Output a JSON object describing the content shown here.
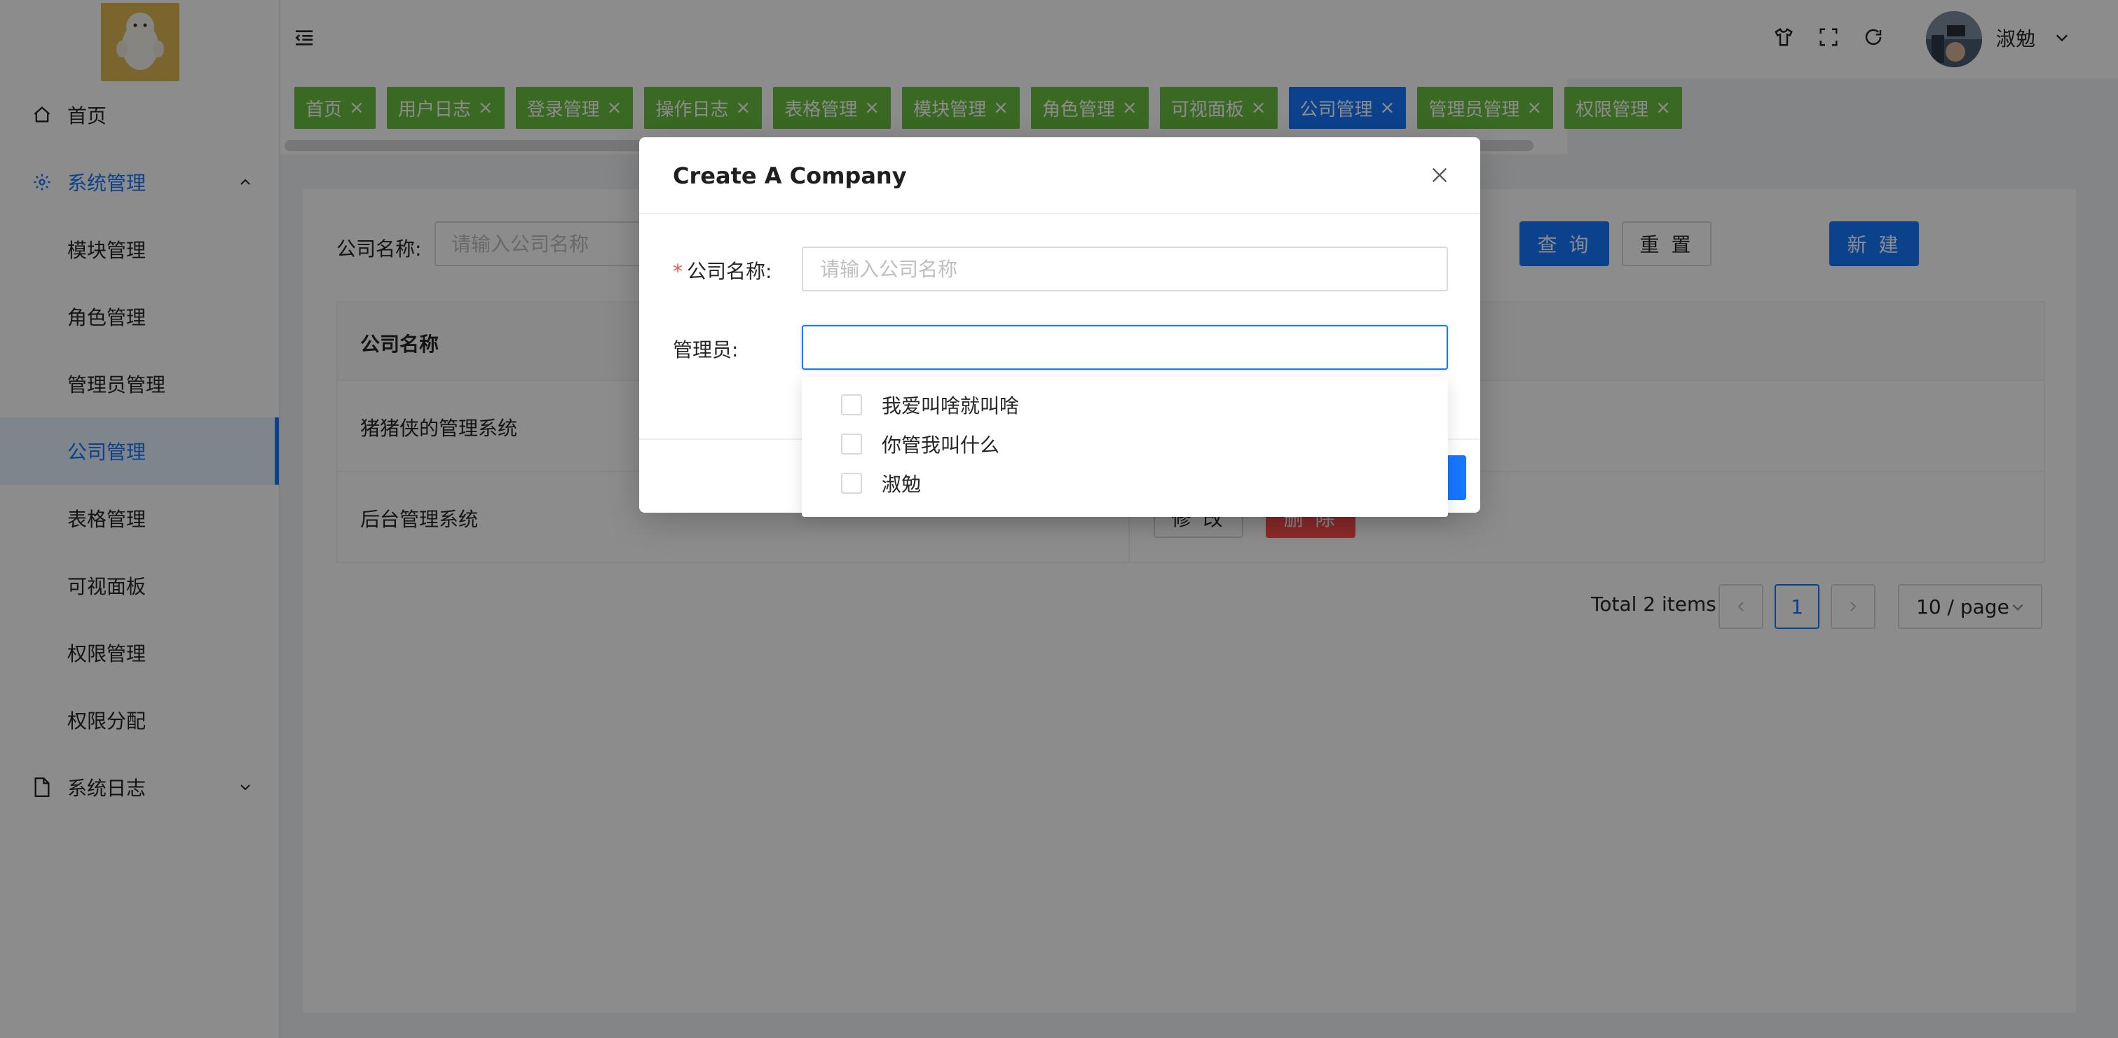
{
  "sidebar": {
    "items": [
      {
        "label": "首页",
        "icon": "home-icon"
      },
      {
        "label": "系统管理",
        "icon": "gear-icon",
        "expanded": true
      },
      {
        "label": "模块管理"
      },
      {
        "label": "角色管理"
      },
      {
        "label": "管理员管理"
      },
      {
        "label": "公司管理",
        "selected": true
      },
      {
        "label": "表格管理"
      },
      {
        "label": "可视面板"
      },
      {
        "label": "权限管理"
      },
      {
        "label": "权限分配"
      },
      {
        "label": "系统日志",
        "icon": "file-icon",
        "expanded": false
      }
    ]
  },
  "header": {
    "username": "淑勉",
    "icons": [
      "menu-fold-icon",
      "shirt-icon",
      "fullscreen-icon",
      "refresh-icon"
    ]
  },
  "tabs": [
    {
      "label": "首页"
    },
    {
      "label": "用户日志"
    },
    {
      "label": "登录管理"
    },
    {
      "label": "操作日志"
    },
    {
      "label": "表格管理"
    },
    {
      "label": "模块管理"
    },
    {
      "label": "角色管理"
    },
    {
      "label": "可视面板"
    },
    {
      "label": "公司管理",
      "active": true
    },
    {
      "label": "管理员管理"
    },
    {
      "label": "权限管理"
    }
  ],
  "filter": {
    "label": "公司名称:",
    "placeholder": "请输入公司名称",
    "search_btn": "查 询",
    "reset_btn": "重 置",
    "create_btn": "新 建"
  },
  "table": {
    "columns": [
      "公司名称"
    ],
    "rows": [
      {
        "name": "猪猪侠的管理系统"
      },
      {
        "name": "后台管理系统"
      }
    ],
    "edit_btn": "修 改",
    "delete_btn": "删 除"
  },
  "pagination": {
    "total": "Total 2 items",
    "current_page": "1",
    "page_size": "10 / page"
  },
  "modal": {
    "title": "Create A Company",
    "company_label": "公司名称:",
    "company_placeholder": "请输入公司名称",
    "admin_label": "管理员:",
    "admin_options": [
      "我爱叫啥就叫啥",
      "你管我叫什么",
      "淑勉"
    ]
  },
  "colors": {
    "primary": "#1677ff",
    "tab_green": "#6abf40",
    "danger": "#ff4d4f"
  }
}
